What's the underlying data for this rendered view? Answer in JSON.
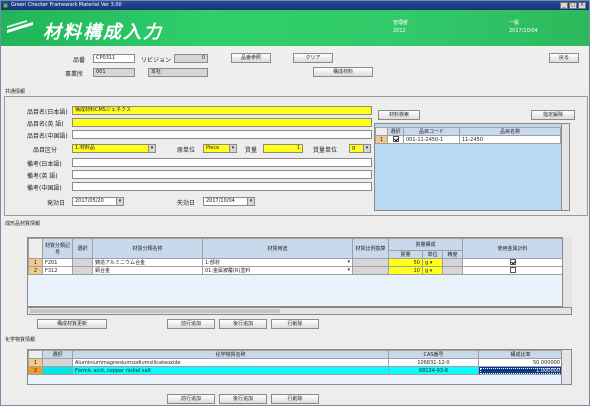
{
  "window": {
    "title": "Green Checker Framework Material Ver 3.00",
    "controls": [
      "_",
      "□",
      "X"
    ]
  },
  "header": {
    "app_title": "材料構成入力",
    "user_role": "管理者",
    "user_id": "2012",
    "mode": "一般",
    "date": "2017/10/04"
  },
  "top_form": {
    "item_no_label": "品番",
    "item_no_value": "CP0311",
    "revision_label": "リビジョン",
    "revision_value": "0",
    "item_ref_button": "品番参照",
    "clear_button": "クリア",
    "back_button": "戻る",
    "office_label": "事業所",
    "office_code": "001",
    "office_name": "本社",
    "constituent_button": "構成材料"
  },
  "basic_info": {
    "section_label": "共通情報",
    "name_jp_label": "品目名(日本語)",
    "name_jp_value": "構成材料CMSジェネクス",
    "name_en_label": "品目名(英 語)",
    "name_zh_label": "品目名(中国語)",
    "category_label": "品目区分",
    "category_value": "1:材料品",
    "unit_label": "原単位",
    "unit_value": "Piece",
    "mass_label": "質量",
    "mass_value": "1",
    "mass_unit_label": "質量単位",
    "mass_unit_value": "g",
    "remark_jp_label": "備考(日本語)",
    "remark_en_label": "備考(英 語)",
    "remark_zh_label": "備考(中国語)",
    "effective_label": "発効日",
    "effective_value": "2017/05/20",
    "expiry_label": "失効日",
    "expiry_value": "2017/10/04",
    "material_search_button": "材料検索",
    "assign_release_button": "指定解除"
  },
  "right_grid": {
    "headers": [
      "選択",
      "品目コード",
      "品目名称"
    ],
    "rows": [
      {
        "num": "1",
        "checked": true,
        "code": "001-11-2450-1",
        "name": "11-2450"
      }
    ]
  },
  "materials": {
    "section_label": "成形品材質情報",
    "headers": [
      "材質分類記号",
      "選択",
      "材質分類名称",
      "材質用途",
      "材質比例換算",
      "質量構成",
      "使用金属計料"
    ],
    "sub_headers": [
      "質量",
      "単位",
      "精度"
    ],
    "rows": [
      {
        "num": "1",
        "code": "F201",
        "name": "鋳造アルミニウム合金",
        "usage": "1:部材",
        "mass": "50",
        "unit": "g",
        "checked": true
      },
      {
        "num": "2",
        "code": "F312",
        "name": "銅合金",
        "usage": "01:金属被覆(R)塗料",
        "mass": "10",
        "unit": "g",
        "checked": false
      }
    ],
    "buttons": [
      "構成材質更新",
      "前行追加",
      "後行追加",
      "行削除"
    ]
  },
  "chemicals": {
    "section_label": "化学物質情報",
    "headers": [
      "選択",
      "化学物質名称",
      "CAS番号",
      "構成比率"
    ],
    "rows": [
      {
        "num": "1",
        "name": "Aluminiummagnesiumsodiumsilicateoxide",
        "cas": "106831-12-0",
        "ratio": "50.000000"
      },
      {
        "num": "2",
        "name": "Formic acid, copper nickel salt",
        "cas": "68134-93-6",
        "ratio": "1.000000"
      }
    ],
    "buttons": [
      "前行追加",
      "後行追加",
      "行削除"
    ]
  },
  "colors": {
    "header_green": "#2fcf6a",
    "title_blue": "#1a3574",
    "required_yellow": "#ffff1a",
    "selected_row_cyan": "#00ffff",
    "row_header_orange": "#f3c88b"
  }
}
